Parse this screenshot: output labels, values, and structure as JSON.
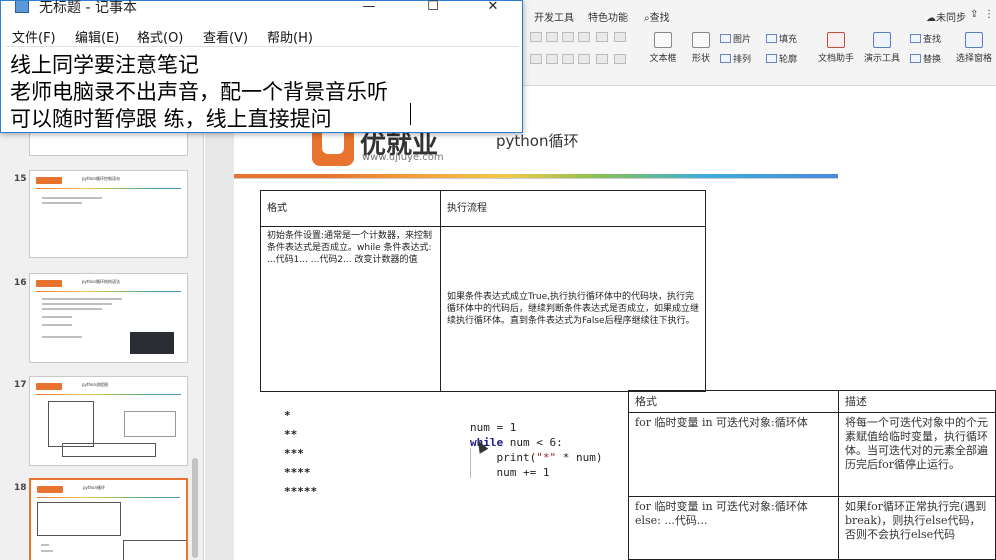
{
  "notepad": {
    "title": "无标题 - 记事本",
    "controls": {
      "minimize": "—",
      "maximize": "☐",
      "close": "✕"
    },
    "menu": [
      "文件(F)",
      "编辑(E)",
      "格式(O)",
      "查看(V)",
      "帮助(H)"
    ],
    "lines": [
      "线上同学要注意笔记",
      "老师电脑录不出声音，配一个背景音乐听",
      "可以随时暂停跟 练，线上直接提问"
    ]
  },
  "ribbon": {
    "tabs": [
      "开发工具",
      "特色功能",
      "查找"
    ],
    "sync_status": "未同步",
    "tools": {
      "textbox": "文本框",
      "shape": "形状",
      "picture": "图片",
      "fill": "填充",
      "arrange": "排列",
      "outline": "轮廓",
      "doc_helper": "文档助手",
      "present_tools": "演示工具",
      "find": "查找",
      "replace": "替换",
      "select_pane": "选择窗格"
    }
  },
  "thumbnails": [
    {
      "num": "15",
      "title": "python循环控制语句"
    },
    {
      "num": "16",
      "title": "python循环结构语法"
    },
    {
      "num": "17",
      "title": "python流程图"
    },
    {
      "num": "18",
      "title": "python循环",
      "selected": true
    }
  ],
  "slide": {
    "brand": "优就业",
    "url": "www.ujiuye.com",
    "title": "python循环",
    "flow_table": {
      "headers": [
        "格式",
        "执行流程"
      ],
      "format_text": "初始条件设置:通常是一个计数器，来控制条件表达式是否成立。while 条件表达式:  ...代码1...  ...代码2...  改变计数器的值",
      "flow_text": "如果条件表达式成立True,执行执行循环体中的代码块，执行完循环体中的代码后，继续判断条件表达式是否成立，如果成立继续执行循环体。直到条件表达式为False后程序继续往下执行。"
    },
    "stars": [
      "*",
      "**",
      "***",
      "****",
      "*****"
    ],
    "code": {
      "line1": "num = 1",
      "kw_while": "while",
      "line2_rest": " num < 6:",
      "line3_pre": "    print(",
      "line3_str": "\"*\"",
      "line3_post": " * num)",
      "line4": "    num += 1"
    },
    "for_table": {
      "headers": [
        "格式",
        "描述"
      ],
      "rows": [
        [
          "for 临时变量 in 可迭代对象:循环体",
          "将每一个可迭代对象中的个元素赋值给临时变量，执行循环体。当可迭代对的元素全部遍历完后for循停止运行。"
        ],
        [
          "for 临时变量 in 可迭代对象:循环体else:  ...代码...",
          "如果for循环正常执行完(遇到break)，则执行else代码，否则不会执行else代码"
        ]
      ]
    }
  }
}
